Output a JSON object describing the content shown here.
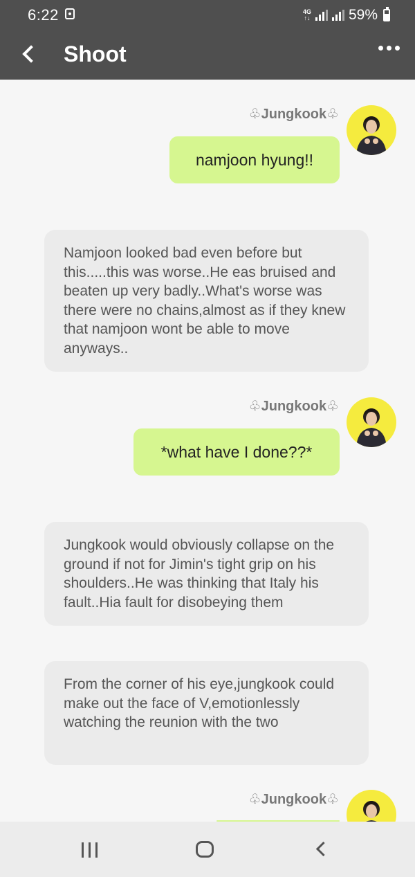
{
  "status_bar": {
    "time": "6:22",
    "network": "4G",
    "battery": "59%"
  },
  "app_bar": {
    "back_icon": "chevron-left-icon",
    "title": "Shoot",
    "menu_icon": "more-dots-icon"
  },
  "messages": [
    {
      "type": "outgoing",
      "sender": "♧Jungkook♧",
      "text": "namjoon hyung!!"
    },
    {
      "type": "narration",
      "text": "Namjoon looked bad even before but this.....this was worse..He eas bruised and beaten up very badly..What's worse was there were no chains,almost as if they knew that namjoon wont be able to move anyways.."
    },
    {
      "type": "outgoing",
      "sender": "♧Jungkook♧",
      "text": "*what have I done??*"
    },
    {
      "type": "narration",
      "text": "Jungkook would obviously collapse on the ground if not for Jimin's tight grip on his shoulders..He was thinking that Italy his fault..Hia fault for disobeying them"
    },
    {
      "type": "narration",
      "text": "From the corner of his eye,jungkook could make out the face of V,emotionlessly watching the reunion with the two"
    },
    {
      "type": "outgoing",
      "sender": "♧Jungkook♧",
      "text": ""
    }
  ],
  "nav_bar": {
    "recent_icon": "recent-apps-icon",
    "home_icon": "home-icon",
    "back_icon": "back-icon"
  },
  "colors": {
    "bar": "#4f4f4f",
    "outgoing_bubble": "#d6f690",
    "narration_bubble": "#ebebeb",
    "avatar_bg": "#f5eb3e"
  }
}
